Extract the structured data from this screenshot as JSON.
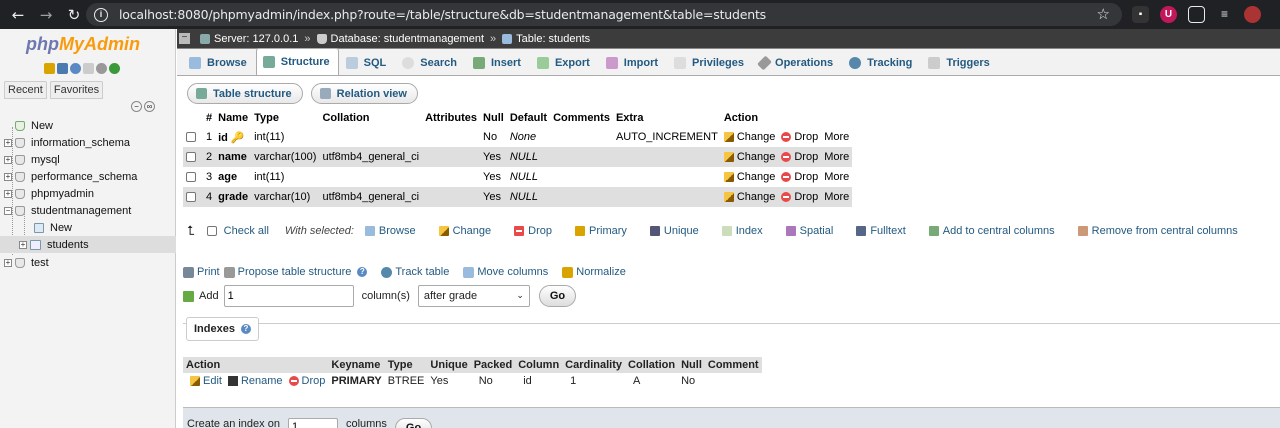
{
  "browser": {
    "url": "localhost:8080/phpmyadmin/index.php?route=/table/structure&db=studentmanagement&table=students"
  },
  "sidebar": {
    "logo_php": "php",
    "logo_myadmin": "MyAdmin",
    "tabs": [
      "Recent",
      "Favorites"
    ],
    "tree": [
      {
        "label": "New"
      },
      {
        "label": "information_schema"
      },
      {
        "label": "mysql"
      },
      {
        "label": "performance_schema"
      },
      {
        "label": "phpmyadmin"
      },
      {
        "label": "studentmanagement"
      },
      {
        "label": "New"
      },
      {
        "label": "students"
      },
      {
        "label": "test"
      }
    ]
  },
  "breadcrumb": {
    "server": "Server: 127.0.0.1",
    "database": "Database: studentmanagement",
    "table": "Table: students"
  },
  "topmenu": [
    "Browse",
    "Structure",
    "SQL",
    "Search",
    "Insert",
    "Export",
    "Import",
    "Privileges",
    "Operations",
    "Tracking",
    "Triggers"
  ],
  "subtabs": [
    "Table structure",
    "Relation view"
  ],
  "structure": {
    "headers": [
      "#",
      "Name",
      "Type",
      "Collation",
      "Attributes",
      "Null",
      "Default",
      "Comments",
      "Extra",
      "Action"
    ],
    "rows": [
      {
        "num": "1",
        "name": "id",
        "type": "int(11)",
        "collation": "",
        "attributes": "",
        "null": "No",
        "default": "None",
        "comments": "",
        "extra": "AUTO_INCREMENT"
      },
      {
        "num": "2",
        "name": "name",
        "type": "varchar(100)",
        "collation": "utf8mb4_general_ci",
        "attributes": "",
        "null": "Yes",
        "default": "NULL",
        "comments": "",
        "extra": ""
      },
      {
        "num": "3",
        "name": "age",
        "type": "int(11)",
        "collation": "",
        "attributes": "",
        "null": "Yes",
        "default": "NULL",
        "comments": "",
        "extra": ""
      },
      {
        "num": "4",
        "name": "grade",
        "type": "varchar(10)",
        "collation": "utf8mb4_general_ci",
        "attributes": "",
        "null": "Yes",
        "default": "NULL",
        "comments": "",
        "extra": ""
      }
    ],
    "actions": {
      "change": "Change",
      "drop": "Drop",
      "more": "More"
    }
  },
  "bulk": {
    "check_all": "Check all",
    "with_selected": "With selected:",
    "items": [
      "Browse",
      "Change",
      "Drop",
      "Primary",
      "Unique",
      "Index",
      "Spatial",
      "Fulltext",
      "Add to central columns",
      "Remove from central columns"
    ]
  },
  "ops": {
    "print": "Print",
    "propose": "Propose table structure",
    "track": "Track table",
    "move": "Move columns",
    "normalize": "Normalize"
  },
  "addcol": {
    "add": "Add",
    "count": "1",
    "columns_label": "column(s)",
    "position": "after grade",
    "go": "Go"
  },
  "indexes": {
    "title": "Indexes",
    "headers": [
      "Action",
      "Keyname",
      "Type",
      "Unique",
      "Packed",
      "Column",
      "Cardinality",
      "Collation",
      "Null",
      "Comment"
    ],
    "row": {
      "edit": "Edit",
      "rename": "Rename",
      "drop": "Drop",
      "keyname": "PRIMARY",
      "type": "BTREE",
      "unique": "Yes",
      "packed": "No",
      "column": "id",
      "cardinality": "1",
      "collation": "A",
      "null": "No",
      "comment": ""
    },
    "create_label": "Create an index on",
    "create_count": "1",
    "create_columns": "columns",
    "create_go": "Go"
  }
}
